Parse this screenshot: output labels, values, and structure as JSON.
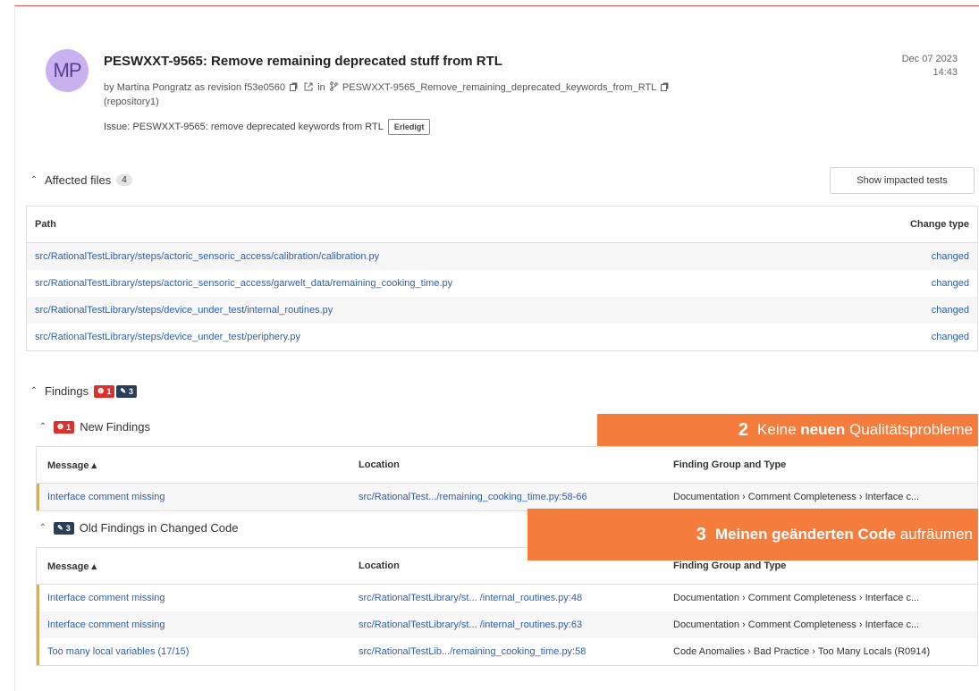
{
  "commit": {
    "avatar_initials": "MP",
    "title": "PESWXXT-9565: Remove remaining deprecated stuff from RTL",
    "by_prefix": "by",
    "author": "Martina Pongratz",
    "as_revision": "as revision",
    "revision": "f53e0560",
    "in_label": "in",
    "branch": "PESWXXT-9565_Remove_remaining_deprecated_keywords_from_RTL",
    "repository": "(repository1)",
    "issue_text": "Issue: PESWXXT-9565: remove deprecated keywords from RTL",
    "issue_status": "Erledigt",
    "date": "Dec 07 2023",
    "time": "14:43"
  },
  "affected_files": {
    "title": "Affected files",
    "count": "4",
    "impacted_button": "Show impacted tests",
    "col_path": "Path",
    "col_change": "Change type",
    "rows": [
      {
        "path": "src/RationalTestLibrary/steps/actoric_sensoric_access/calibration/calibration.py",
        "change": "changed"
      },
      {
        "path": "src/RationalTestLibrary/steps/actoric_sensoric_access/garwelt_data/remaining_cooking_time.py",
        "change": "changed"
      },
      {
        "path": "src/RationalTestLibrary/steps/device_under_test/internal_routines.py",
        "change": "changed"
      },
      {
        "path": "src/RationalTestLibrary/steps/device_under_test/periphery.py",
        "change": "changed"
      }
    ]
  },
  "findings": {
    "title": "Findings",
    "new_count": "1",
    "old_count": "3",
    "new_section": {
      "title": "New Findings",
      "count": "1",
      "col_message": "Message ▴",
      "col_location": "Location",
      "col_group": "Finding Group and Type",
      "rows": [
        {
          "message": "Interface comment missing",
          "location": "src/RationalTest.../remaining_cooking_time.py:58-66",
          "group": "Documentation › Comment Completeness › Interface c..."
        }
      ]
    },
    "old_section": {
      "title": "Old Findings in Changed Code",
      "count": "3",
      "col_message": "Message ▴",
      "col_location": "Location",
      "col_group": "Finding Group and Type",
      "rows": [
        {
          "message": "Interface comment missing",
          "location": "src/RationalTestLibrary/st... /internal_routines.py:48",
          "group": "Documentation › Comment Completeness › Interface c..."
        },
        {
          "message": "Interface comment missing",
          "location": "src/RationalTestLibrary/st... /internal_routines.py:63",
          "group": "Documentation › Comment Completeness › Interface c..."
        },
        {
          "message": "Too many local variables (17/15)",
          "location": "src/RationalTestLib.../remaining_cooking_time.py:58",
          "group": "Code Anomalies › Bad Practice › Too Many Locals (R0914)"
        }
      ]
    }
  },
  "overlays": {
    "o2": {
      "num": "2",
      "pre": "Keine ",
      "bold": "neuen",
      "post": " Qualitätsprobleme"
    },
    "o3": {
      "num": "3",
      "bold": "Meinen geänderten Code",
      "post": " aufräumen"
    }
  },
  "colors": {
    "accent_orange": "#f47c3c",
    "link_blue": "#2f5fa8",
    "finding_red": "#d9312c",
    "finding_dark": "#2c3e57",
    "avatar": "#c9b1ef"
  }
}
